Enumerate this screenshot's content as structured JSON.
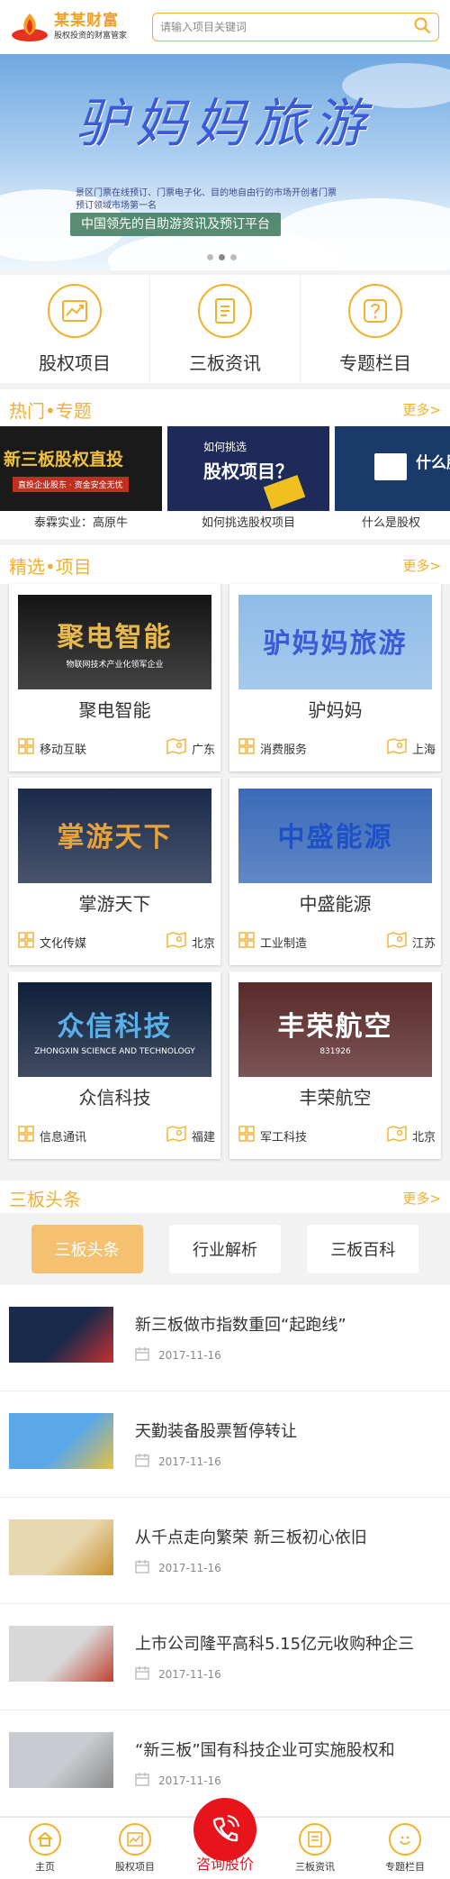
{
  "header": {
    "logo_name": "某某财富",
    "logo_slogan": "股权投资的财富管家",
    "search_placeholder": "请输入项目关键词"
  },
  "banner": {
    "title": "驴妈妈旅游",
    "desc": "景区门票在线预订、门票电子化、目的地自由行的市场开创者门票预订领域市场第一名",
    "strip": "中国领先的自助游资讯及预订平台",
    "slides": 3,
    "active_slide": 1
  },
  "quicknav": [
    {
      "label": "股权项目",
      "icon": "chart-icon"
    },
    {
      "label": "三板资讯",
      "icon": "document-icon"
    },
    {
      "label": "专题栏目",
      "icon": "question-icon"
    }
  ],
  "hot": {
    "title": "热门•专题",
    "more": "更多>",
    "items": [
      {
        "caption": "泰霖实业：高原牛",
        "img_text": "新三板股权直投",
        "img_sub": "直投企业股东 · 资金安全无忧"
      },
      {
        "caption": "如何挑选股权项目",
        "img_text": "股权项目？",
        "img_sub": "如何挑选"
      },
      {
        "caption": "什么是股权",
        "img_text": "什么股权",
        "img_sub": ""
      }
    ]
  },
  "projects": {
    "title": "精选•项目",
    "more": "更多>",
    "items": [
      {
        "name": "聚电智能",
        "industry": "移动互联",
        "region": "广东",
        "img_text": "聚电智能",
        "img_sub": "物联网技术产业化领军企业",
        "bg": "#141414",
        "fg": "#e8b84a"
      },
      {
        "name": "驴妈妈",
        "industry": "消费服务",
        "region": "上海",
        "img_text": "驴妈妈旅游",
        "img_sub": "",
        "bg": "#8fbce8",
        "fg": "#3a5ad8"
      },
      {
        "name": "掌游天下",
        "industry": "文化传媒",
        "region": "北京",
        "img_text": "掌游天下",
        "img_sub": "",
        "bg": "#1b2a4a",
        "fg": "#e8a23a"
      },
      {
        "name": "中盛能源",
        "industry": "工业制造",
        "region": "江苏",
        "img_text": "中盛能源",
        "img_sub": "",
        "bg": "#3a6ab8",
        "fg": "#1e50c8"
      },
      {
        "name": "众信科技",
        "industry": "信息通讯",
        "region": "福建",
        "img_text": "众信科技",
        "img_sub": "ZHONGXIN SCIENCE AND TECHNOLOGY",
        "bg": "#0f1f3a",
        "fg": "#5ab0e8"
      },
      {
        "name": "丰荣航空",
        "industry": "军工科技",
        "region": "北京",
        "img_text": "丰荣航空",
        "img_sub": "831926",
        "bg": "#5a2a2a",
        "fg": "#ffffff"
      }
    ]
  },
  "news_section": {
    "title": "三板头条",
    "more": "更多>",
    "tabs": [
      "三板头条",
      "行业解析",
      "三板百科"
    ],
    "active_tab": 0,
    "items": [
      {
        "title": "新三板做市指数重回“起跑线”",
        "date": "2017-11-16"
      },
      {
        "title": "天勤装备股票暂停转让",
        "date": "2017-11-16"
      },
      {
        "title": "从千点走向繁荣 新三板初心依旧",
        "date": "2017-11-16"
      },
      {
        "title": "上市公司隆平高科5.15亿元收购种企三",
        "date": "2017-11-16"
      },
      {
        "title": "“新三板”国有科技企业可实施股权和",
        "date": "2017-11-16"
      }
    ]
  },
  "bottomnav": [
    {
      "label": "主页",
      "icon": "home-icon"
    },
    {
      "label": "股权项目",
      "icon": "chart-icon"
    },
    {
      "label": "咨询股价",
      "icon": "phone-icon"
    },
    {
      "label": "三板资讯",
      "icon": "document-icon"
    },
    {
      "label": "专题栏目",
      "icon": "smile-icon"
    }
  ],
  "colors": {
    "accent": "#f0b030",
    "call": "#e8141c",
    "tab_active": "#f5c170"
  }
}
